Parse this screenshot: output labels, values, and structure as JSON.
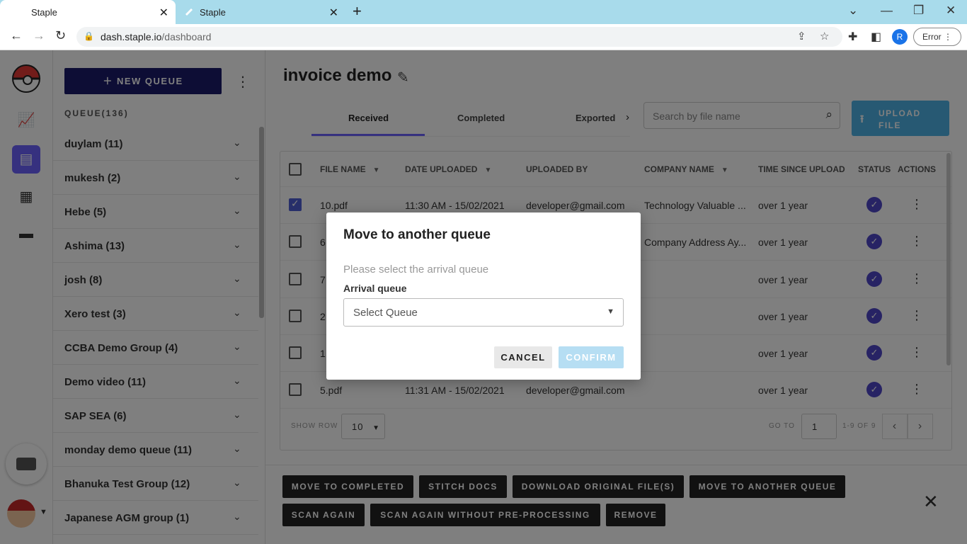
{
  "browser": {
    "tabs": [
      {
        "title": "Staple",
        "active": true
      },
      {
        "title": "Staple",
        "active": false
      }
    ],
    "url_host": "dash.staple.io",
    "url_path": "/dashboard",
    "profile_initial": "R",
    "error_label": "Error"
  },
  "sidebar": {
    "new_queue_label": "NEW QUEUE",
    "queue_count_label": "QUEUE(136)",
    "queues": [
      "duylam (11)",
      "mukesh (2)",
      "Hebe (5)",
      "Ashima (13)",
      "josh (8)",
      "Xero test (3)",
      "CCBA Demo Group (4)",
      "Demo video (11)",
      "SAP SEA (6)",
      "monday demo queue (11)",
      "Bhanuka Test Group (12)",
      "Japanese AGM group (1)"
    ]
  },
  "main": {
    "title": "invoice demo",
    "tabs": [
      "Received",
      "Completed",
      "Exported"
    ],
    "search_placeholder": "Search by file name",
    "upload_label": "UPLOAD FILE",
    "columns": [
      "FILE NAME",
      "DATE UPLOADED",
      "UPLOADED BY",
      "COMPANY NAME",
      "TIME SINCE UPLOAD",
      "STATUS",
      "ACTIONS"
    ],
    "rows": [
      {
        "file": "10.pdf",
        "date": "11:30 AM - 15/02/2021",
        "by": "developer@gmail.com",
        "company": "Technology Valuable ...",
        "since": "over 1 year",
        "checked": true
      },
      {
        "file": "6",
        "date": "",
        "by": "",
        "company": "Company Address Ay...",
        "since": "over 1 year",
        "checked": false
      },
      {
        "file": "7.",
        "date": "",
        "by": "",
        "company": "",
        "since": "over 1 year",
        "checked": false
      },
      {
        "file": "2",
        "date": "",
        "by": "",
        "company": "",
        "since": "over 1 year",
        "checked": false
      },
      {
        "file": "1.",
        "date": "",
        "by": "",
        "company": "",
        "since": "over 1 year",
        "checked": false
      },
      {
        "file": "5.pdf",
        "date": "11:31 AM - 15/02/2021",
        "by": "developer@gmail.com",
        "company": "",
        "since": "over 1 year",
        "checked": false
      }
    ],
    "pager": {
      "show_row_label": "SHOW ROW",
      "rows_value": "10",
      "go_to_label": "GO TO",
      "page_value": "1",
      "range_label": "1-9 OF 9"
    },
    "bulk_actions": [
      "MOVE TO COMPLETED",
      "STITCH DOCS",
      "DOWNLOAD ORIGINAL FILE(S)",
      "MOVE TO ANOTHER QUEUE",
      "SCAN AGAIN",
      "SCAN AGAIN WITHOUT PRE-PROCESSING",
      "REMOVE"
    ]
  },
  "dialog": {
    "title": "Move to another queue",
    "subtitle": "Please select the arrival queue",
    "field_label": "Arrival queue",
    "select_value": "Select Queue",
    "cancel_label": "CANCEL",
    "confirm_label": "CONFIRM"
  },
  "colors": {
    "accent": "#6c63ff",
    "new_queue_bg": "#1b1b6b",
    "upload_bg": "#4fb3e6",
    "confirm_disabled": "#b6def3",
    "status_ok": "#4f46c8"
  }
}
